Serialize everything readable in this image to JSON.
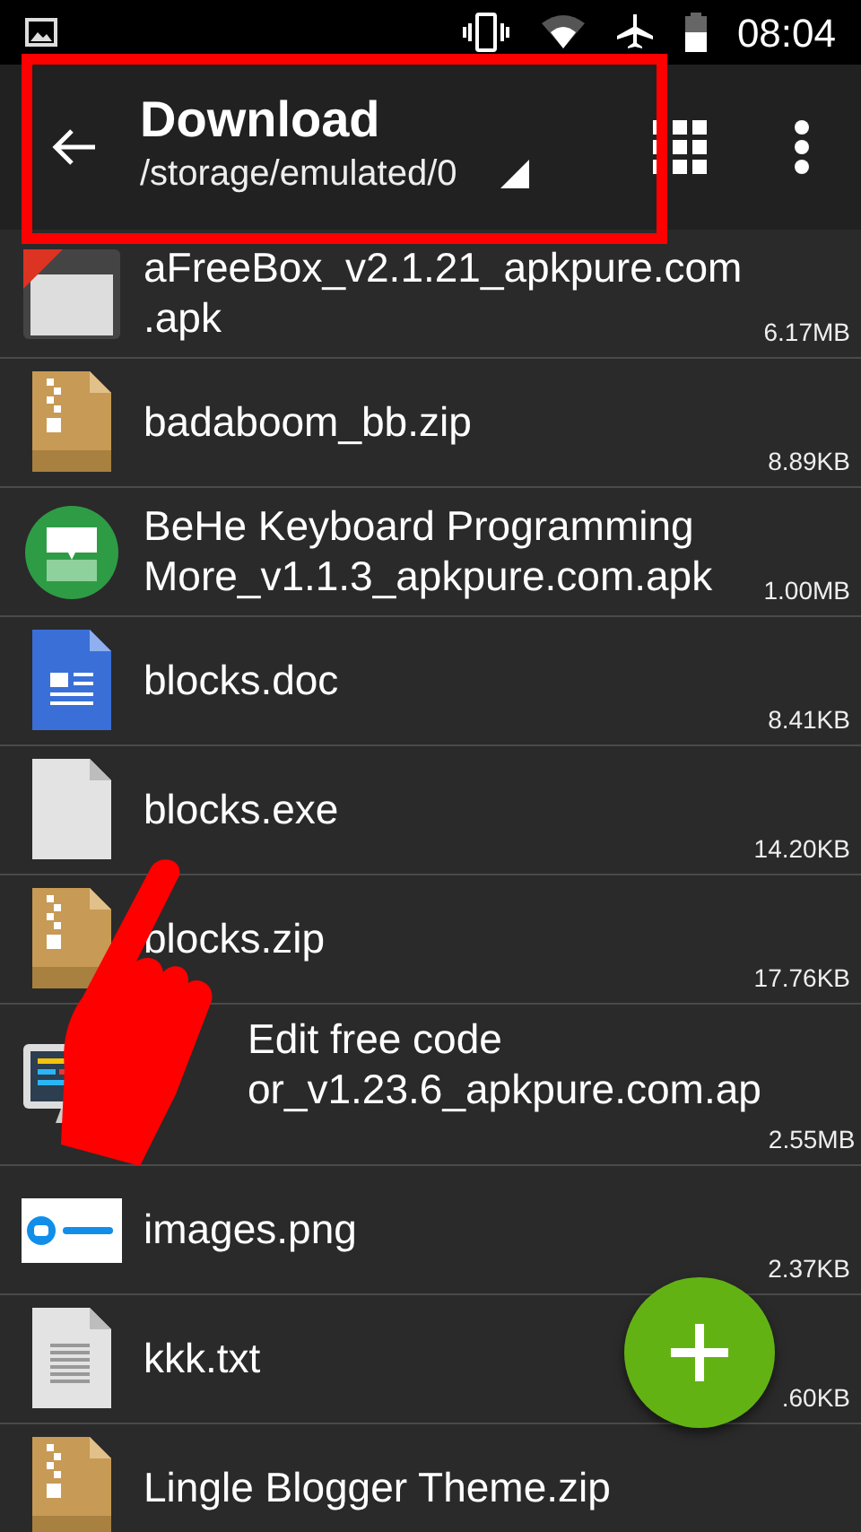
{
  "status_bar": {
    "time": "08:04"
  },
  "toolbar": {
    "title": "Download",
    "path": "/storage/emulated/0"
  },
  "files": [
    {
      "kind": "app_box",
      "lines": [
        "aFreeBox_v2.1.21_apkpure.com",
        ".apk"
      ],
      "size": "6.17MB"
    },
    {
      "kind": "archive",
      "lines": [
        "badaboom_bb.zip"
      ],
      "size": "8.89KB"
    },
    {
      "kind": "app_keyboard",
      "lines": [
        "BeHe Keyboard Programming",
        "More_v1.1.3_apkpure.com.apk"
      ],
      "size": "1.00MB"
    },
    {
      "kind": "document",
      "lines": [
        "blocks.doc"
      ],
      "size": "8.41KB"
    },
    {
      "kind": "blank",
      "lines": [
        "blocks.exe"
      ],
      "size": "14.20KB"
    },
    {
      "kind": "archive",
      "lines": [
        "blocks.zip"
      ],
      "size": "17.76KB"
    },
    {
      "kind": "app_monitor",
      "partly_hidden": true,
      "lines": [
        "Edit free code",
        "or_v1.23.6_apkpure.com.ap"
      ],
      "size": "2.55MB"
    },
    {
      "lines": [
        "images.png"
      ],
      "size": "2.37KB"
    },
    {
      "kind": "text",
      "lines": [
        "kkk.txt"
      ],
      "size": ".60KB"
    },
    {
      "kind": "archive",
      "lines": [
        "Lingle Blogger Theme.zip"
      ]
    }
  ],
  "highlight_frame": true,
  "pointer_hand": true
}
